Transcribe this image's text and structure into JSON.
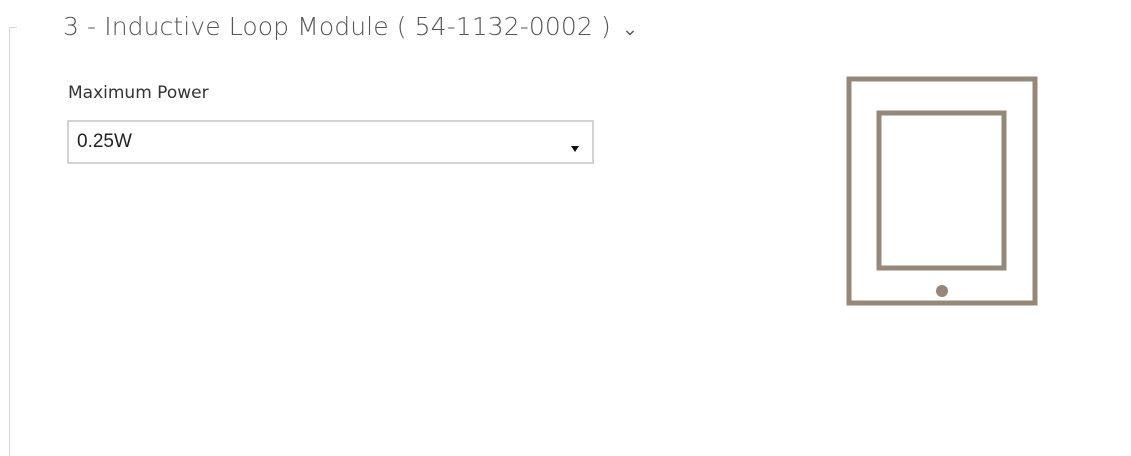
{
  "module": {
    "title": "3 - Inductive Loop Module ( 54-1132-0002 )",
    "toggle_icon": "chevron-down-icon"
  },
  "settings": {
    "maximum_power": {
      "label": "Maximum Power",
      "selected": "0.25W"
    }
  },
  "preview": {
    "icon": "tablet-device-icon",
    "color": "#968879"
  },
  "colors": {
    "frame": "#d7d7d7",
    "input_border": "#d3d3d3",
    "title_text": "#555555"
  }
}
